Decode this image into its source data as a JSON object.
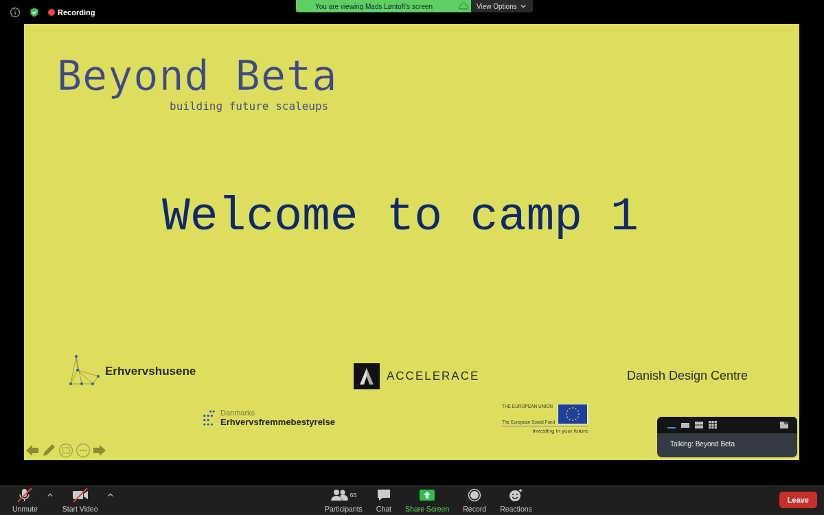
{
  "top_bar": {
    "recording_label": "Recording",
    "share_banner": "You are viewing Mads Løntoft's screen",
    "view_options": "View Options"
  },
  "slide": {
    "title": "Beyond Beta",
    "tagline": "building future scaleups",
    "heading": "Welcome to camp 1",
    "logo_erhvervshusene": "Erhvervshusene",
    "logo_accelerace": "ACCELERACE",
    "logo_ddc": "Danish Design Centre",
    "logo_board": {
      "line_1": "Danmarks",
      "line_2": "Erhvervsfremmebestyrelse"
    },
    "logo_eu": {
      "line_1": "THE EUROPEAN UNION",
      "line_2": "The European Social Fund",
      "tagline": "Investing in your future"
    }
  },
  "video_panel": {
    "layouts": [
      {
        "kind": "speaker",
        "selected": true
      },
      {
        "kind": "single",
        "selected": false
      },
      {
        "kind": "split",
        "selected": false
      },
      {
        "kind": "grid",
        "selected": false
      }
    ],
    "talking": "Talking: Beyond Beta"
  },
  "toolbar": {
    "left": [
      {
        "kind": "mic",
        "label": "Unmute",
        "off": true
      },
      {
        "kind": "video",
        "label": "Start Video",
        "off": true
      }
    ],
    "center": [
      {
        "kind": "participants",
        "label": "Participants",
        "count": "65"
      },
      {
        "kind": "chat",
        "label": "Chat"
      },
      {
        "kind": "share",
        "label": "Share Screen"
      },
      {
        "kind": "record",
        "label": "Record"
      },
      {
        "kind": "reactions",
        "label": "Reactions"
      }
    ],
    "leave": "Leave"
  }
}
